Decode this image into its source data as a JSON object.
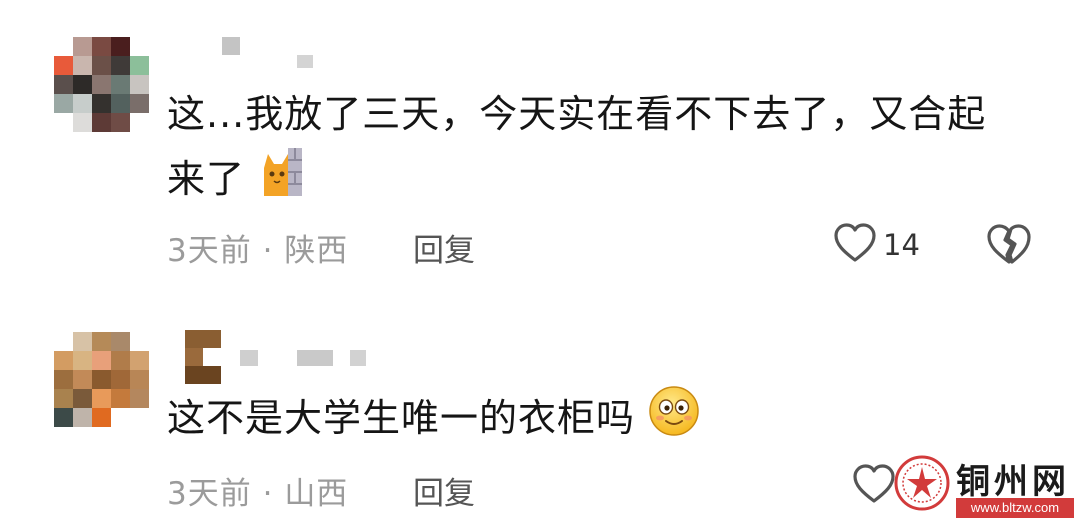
{
  "comments": [
    {
      "text_line1": "这...我放了三天，今天实在看不下去了，又合起",
      "text_line2": "来了",
      "emoji": "cat-behind-wall-emoji",
      "time": "3天前",
      "separator": "·",
      "location": "陕西",
      "reply_label": "回复",
      "like_count": "14"
    },
    {
      "text_line1": "这不是大学生唯一的衣柜吗",
      "emoji": "smiling-face-emoji",
      "time": "3天前",
      "separator": "·",
      "location": "山西",
      "reply_label": "回复"
    }
  ],
  "icons": {
    "like": "heart-outline-icon",
    "dislike": "broken-heart-icon"
  },
  "watermark": {
    "name": "铜州网",
    "url": "www.bltzw.com"
  },
  "colors": {
    "text": "#151515",
    "meta": "#9b9b9b",
    "reply": "#555555",
    "watermark_red": "#d23b3b"
  }
}
